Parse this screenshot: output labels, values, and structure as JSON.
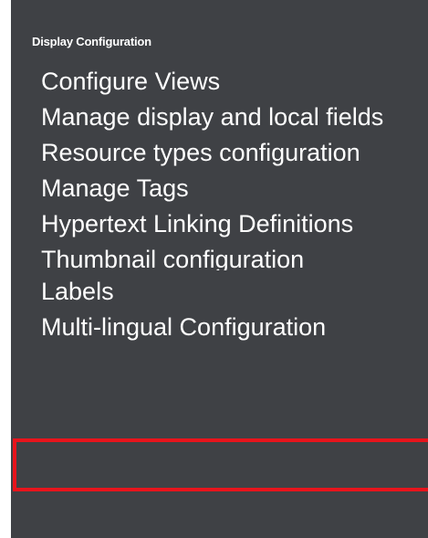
{
  "sidebar": {
    "section_title": "Display Configuration",
    "items": [
      {
        "label": "Configure Views"
      },
      {
        "label": "Manage display and local fields"
      },
      {
        "label": "Resource types configuration"
      },
      {
        "label": "Manage Tags"
      },
      {
        "label": "Hypertext Linking Definitions"
      },
      {
        "label": "Thumbnail configuration"
      },
      {
        "label": "Labels"
      },
      {
        "label": "Multi-lingual Configuration"
      }
    ]
  },
  "highlight": {
    "target": "Labels",
    "color": "#e8141c"
  },
  "colors": {
    "panel_background": "#3f4145",
    "text": "#ffffff"
  }
}
